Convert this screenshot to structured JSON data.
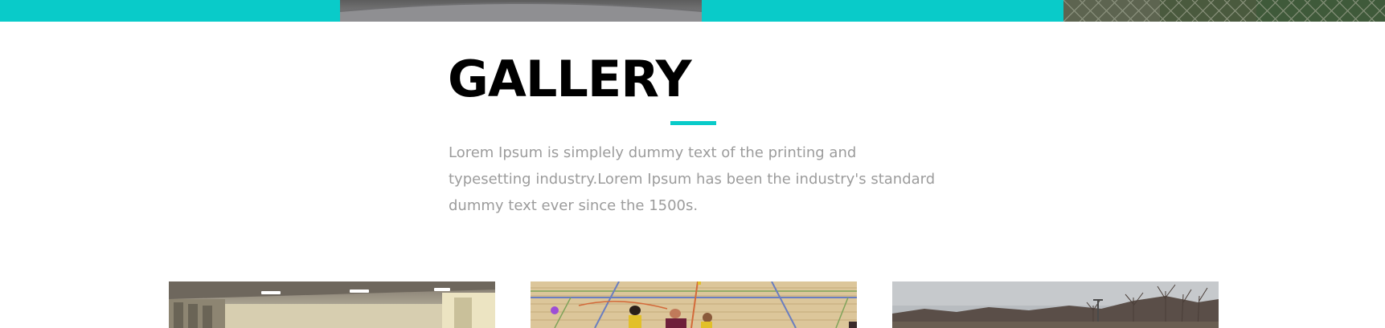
{
  "colors": {
    "accent": "#09cbc9",
    "heading": "#000000",
    "body_text": "#9c9c9c",
    "background": "#ffffff"
  },
  "top_strip": {
    "tiles": [
      {
        "type": "color",
        "color": "#09cbc9"
      },
      {
        "type": "photo",
        "subject": "grey-ground-photo"
      },
      {
        "type": "color",
        "color": "#09cbc9"
      },
      {
        "type": "photo",
        "subject": "chain-link-fence-photo"
      }
    ]
  },
  "gallery": {
    "title": "GALLERY",
    "intro": "Lorem Ipsum is simplely dummy text of the printing and typesetting industry.Lorem Ipsum has been the industry's standard dummy text ever since the 1500s.",
    "images": [
      {
        "subject": "indoor-hall-photo"
      },
      {
        "subject": "gym-floor-kids-playing-photo"
      },
      {
        "subject": "bare-trees-field-photo"
      }
    ]
  }
}
